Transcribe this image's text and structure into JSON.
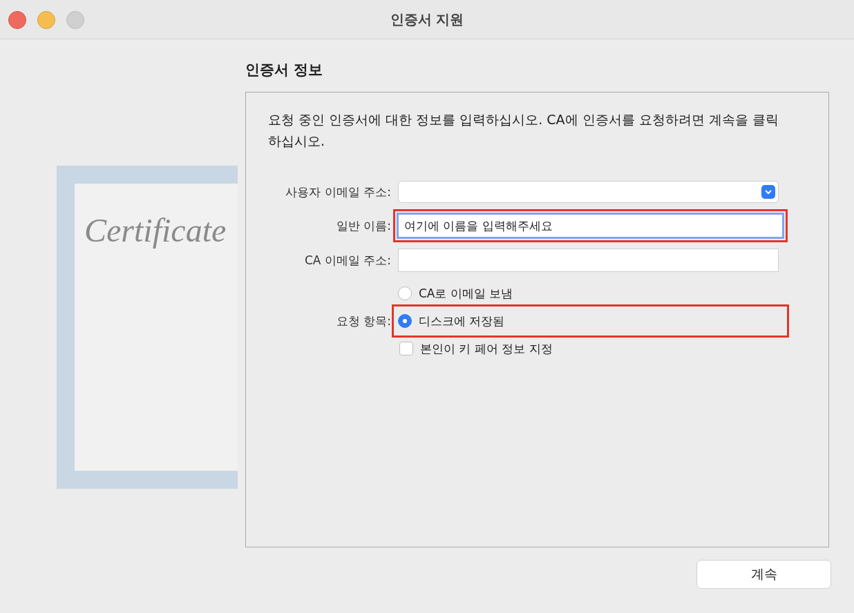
{
  "window": {
    "title": "인증서 지원"
  },
  "certificate_art": {
    "text": "Certificate"
  },
  "section": {
    "heading": "인증서 정보",
    "description": "요청 중인 인증서에 대한 정보를 입력하십시오. CA에 인증서를 요청하려면 계속을 클릭하십시오."
  },
  "form": {
    "fields": [
      {
        "kind": "dropdown",
        "label": "사용자 이메일 주소:",
        "highlighted": false
      },
      {
        "kind": "text",
        "label": "일반 이름:",
        "value": "여기에 이름을 입력해주세요",
        "focused": true,
        "highlighted": true
      },
      {
        "kind": "text",
        "label": "CA 이메일 주소:",
        "focused": false,
        "highlighted": false
      }
    ],
    "request": {
      "label": "요청 항목:",
      "options": [
        {
          "label": "CA로 이메일 보냄",
          "selected": false,
          "highlighted": false
        },
        {
          "label": "디스크에 저장됨",
          "selected": true,
          "highlighted": true
        }
      ]
    },
    "checkbox": {
      "label": "본인이 키 페어 정보 지정",
      "checked": false
    }
  },
  "buttons": [
    {
      "label": "계속"
    }
  ]
}
